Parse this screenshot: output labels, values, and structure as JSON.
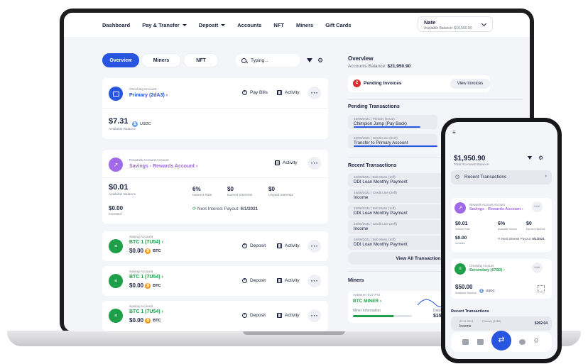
{
  "topnav": {
    "items": [
      "Dashboard",
      "Pay & Transfer",
      "Deposit",
      "Accounts",
      "NFT",
      "Miners",
      "Gift Cards"
    ],
    "user_name": "Nate",
    "user_balance": "Available Balance: $19,560.00"
  },
  "tabs": [
    "Overview",
    "Miners",
    "NFT"
  ],
  "search": {
    "placeholder": "Typing..."
  },
  "checking": {
    "type": "Checking Account",
    "name": "Primary (2dA3)",
    "pay_bills": "Pay Bills",
    "activity": "Activity",
    "amount": "$7.31",
    "currency": "USDC",
    "amount_label": "Available Balance"
  },
  "rewards": {
    "type": "Rewards Account Account",
    "name": "Savings - Rewards Account",
    "activity": "Activity",
    "amount": "$0.01",
    "amount_label": "Available Balance",
    "interest_rate": "6%",
    "interest_rate_label": "Interest Rate",
    "earned": "$0",
    "earned_label": "Earned Interests",
    "unpaid": "$0",
    "unpaid_label": "Unpaid Interests",
    "invested": "$0.00",
    "invested_label": "Invested",
    "next_payout_label": "Next Interest Payout:",
    "next_payout_date": "6/1/2021"
  },
  "savings": [
    {
      "type": "Saving Account",
      "name": "BTC 1 (7U54)",
      "amount": "$0.00",
      "coin": "BTC",
      "deposit": "Deposit",
      "activity": "Activity"
    },
    {
      "type": "Saving Account",
      "name": "BTC 1 (7U54)",
      "amount": "$0.00",
      "coin": "BTC",
      "deposit": "Deposit",
      "activity": "Activity"
    },
    {
      "type": "Saving Account",
      "name": "BTC 1 (7U54)",
      "amount": "$0.00",
      "coin": "BTC",
      "deposit": "Deposit",
      "activity": "Activity"
    }
  ],
  "overview": {
    "title": "Overview",
    "balance_label": "Accounts Balance:",
    "balance": "$21,950.90",
    "pending_count": "2",
    "pending_label": "Pending Invoices",
    "view_invoices": "View Invoices"
  },
  "pending_tx": {
    "title": "Pending Transactions",
    "items": [
      {
        "meta": "16/06/2021  |  Primary (6cU2)",
        "name": "Chimpion Jump (Pay Back)"
      },
      {
        "meta": "16/06/2021  |  Credit Line (5ccf)",
        "name": "Transfer to Primary Account"
      }
    ]
  },
  "recent_tx": {
    "title": "Recent Transactions",
    "items": [
      {
        "meta": "16/06/2021  |  Bob Mass (1cff)",
        "name": "DDI Loan Monthly Payment"
      },
      {
        "meta": "16/06/2021  |  Credit Line (2eff)",
        "name": "Income"
      },
      {
        "meta": "16/06/2021  |  Bob Mass (1cff)",
        "name": "DDI Loan Monthly Payment"
      },
      {
        "meta": "16/06/2021  |  Credit Line (2eff)",
        "name": "Income"
      },
      {
        "meta": "16/06/2021  |  Bob Mass (1cff)",
        "name": "DDI Loan Monthly Payment"
      }
    ],
    "view_all": "View All Transactions"
  },
  "miners": {
    "title": "Miners",
    "model": "Antminer S17 Pro",
    "name": "BTC MINER",
    "info_label": "Miner Information",
    "daily_label": "Daily",
    "daily_value": "$15"
  },
  "phone": {
    "balance": "$1,950.90",
    "balance_label": "Total Accounts Balance",
    "recent_tx_button": "Recent Transactions",
    "rewards": {
      "type": "Rewards Account Account",
      "name": "Savings - Rewards Account",
      "amount": "$0.01",
      "amount_label": "Interest Rate",
      "rate": "6%",
      "rate_label": "Available Income",
      "earned": "$0",
      "earned_label": "Earned Interests",
      "invested": "$0.00",
      "invested_label": "Invested",
      "next_payout_label": "Next Interest Payout:",
      "next_payout_date": "6/1/2021"
    },
    "checking": {
      "type": "Checking Account",
      "name": "Secondary (670D)",
      "amount": "$50.00",
      "currency": "USDC",
      "amount_label": "Available Balance"
    },
    "recent_title": "Recent Transactions",
    "recent_item": {
      "date": "22.11.2021",
      "account": "Primary (1289)",
      "name": "Income",
      "amount": "$202.04"
    }
  }
}
